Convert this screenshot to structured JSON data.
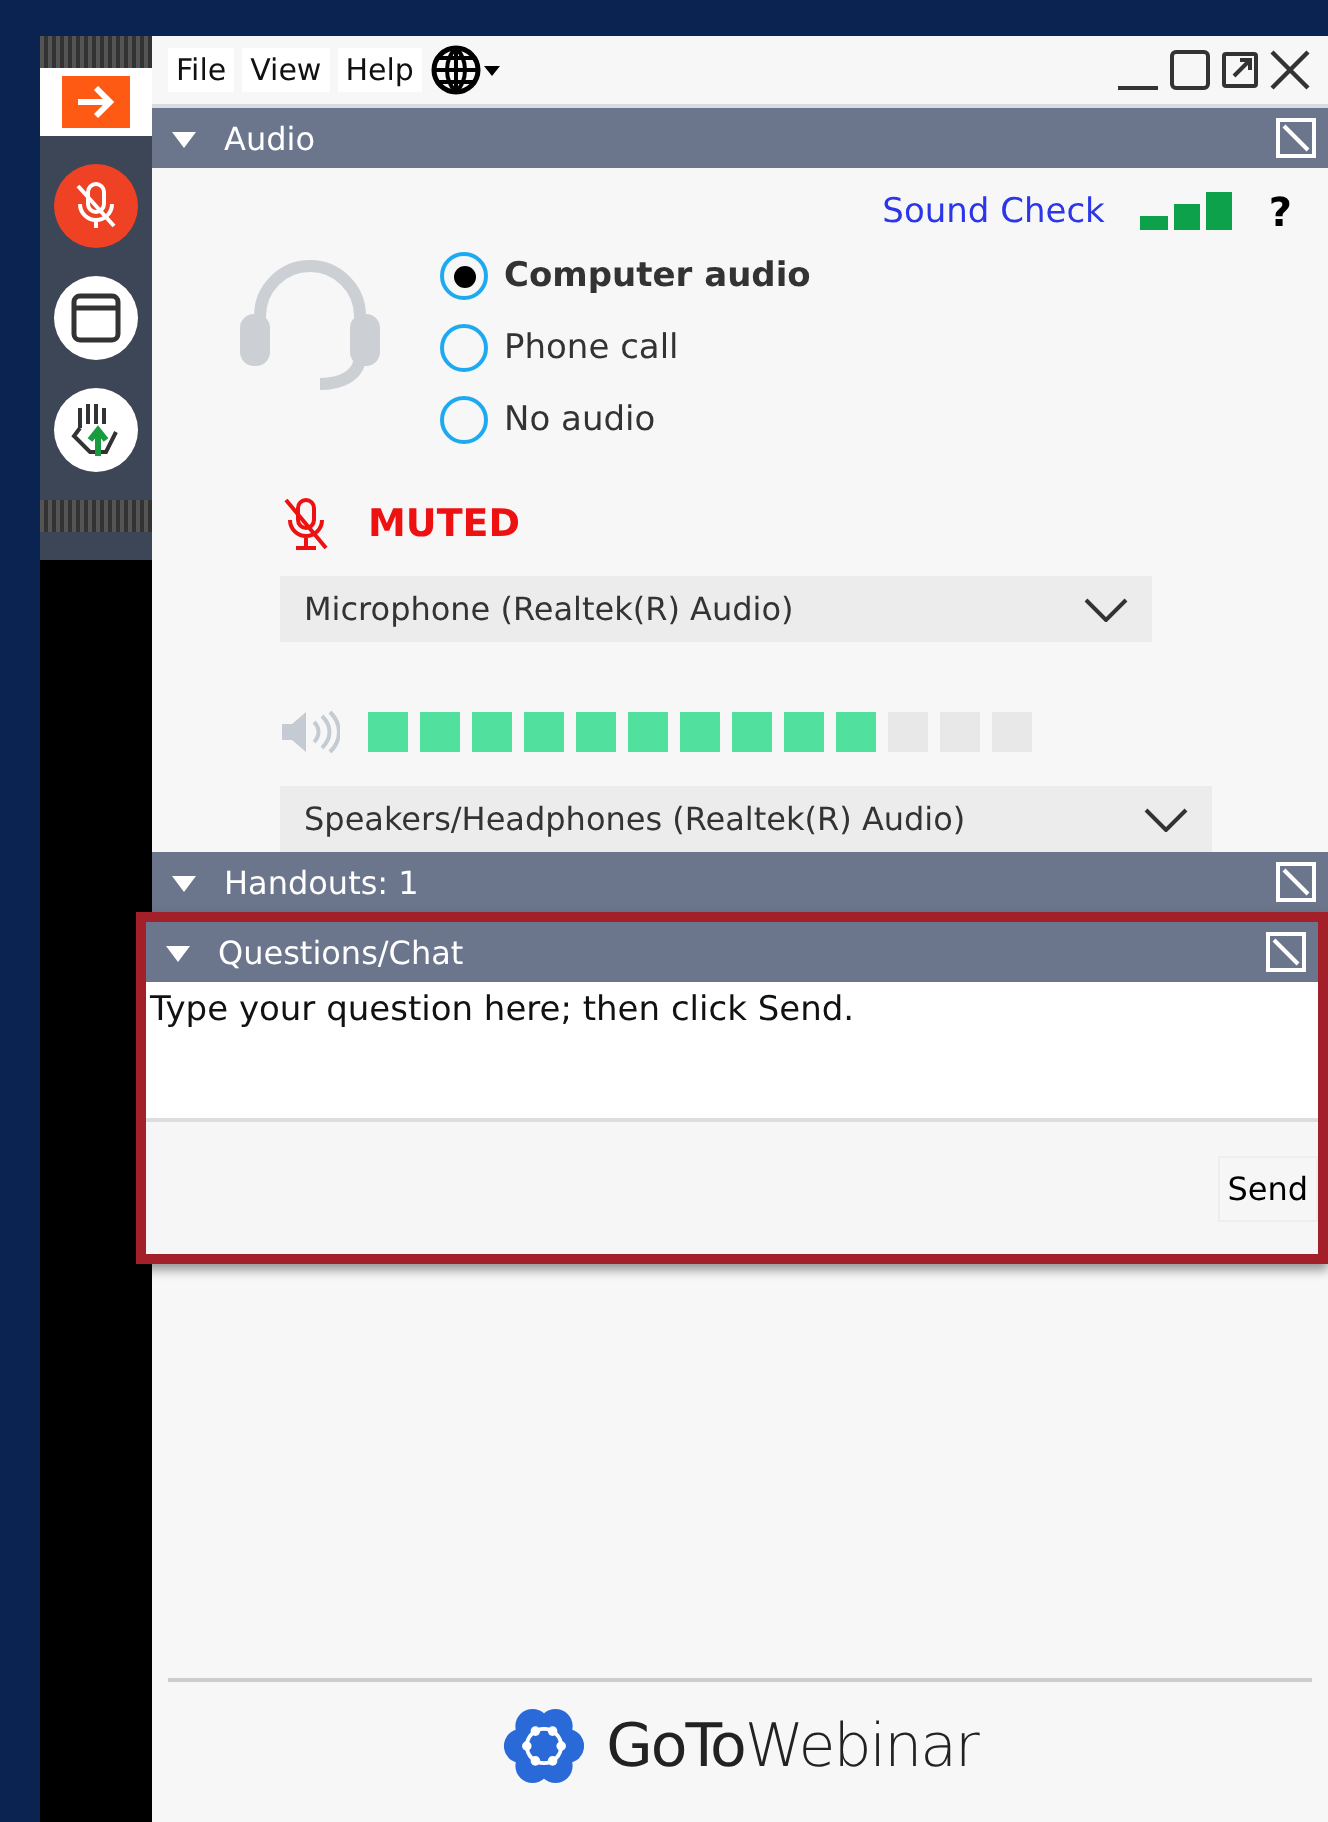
{
  "menu": [
    "File",
    "View",
    "Help"
  ],
  "audio": {
    "title": "Audio",
    "expanded": true,
    "sound_check": "Sound Check",
    "help": "?",
    "options": [
      {
        "label": "Computer audio",
        "selected": true
      },
      {
        "label": "Phone call",
        "selected": false
      },
      {
        "label": "No audio",
        "selected": false
      }
    ],
    "mic_status": "MUTED",
    "microphone": "Microphone (Realtek(R) Audio)",
    "speaker_meter": {
      "level": 0.77
    },
    "speakers": "Speakers/Headphones (Realtek(R) Audio)"
  },
  "handouts": {
    "title": "Handouts: 1",
    "expanded": true
  },
  "questions": {
    "title": "Questions/Chat",
    "expanded": true,
    "placeholder": "Type your question here; then click Send.",
    "send": "Send"
  },
  "logo": "**GoTo**Webinar"
}
